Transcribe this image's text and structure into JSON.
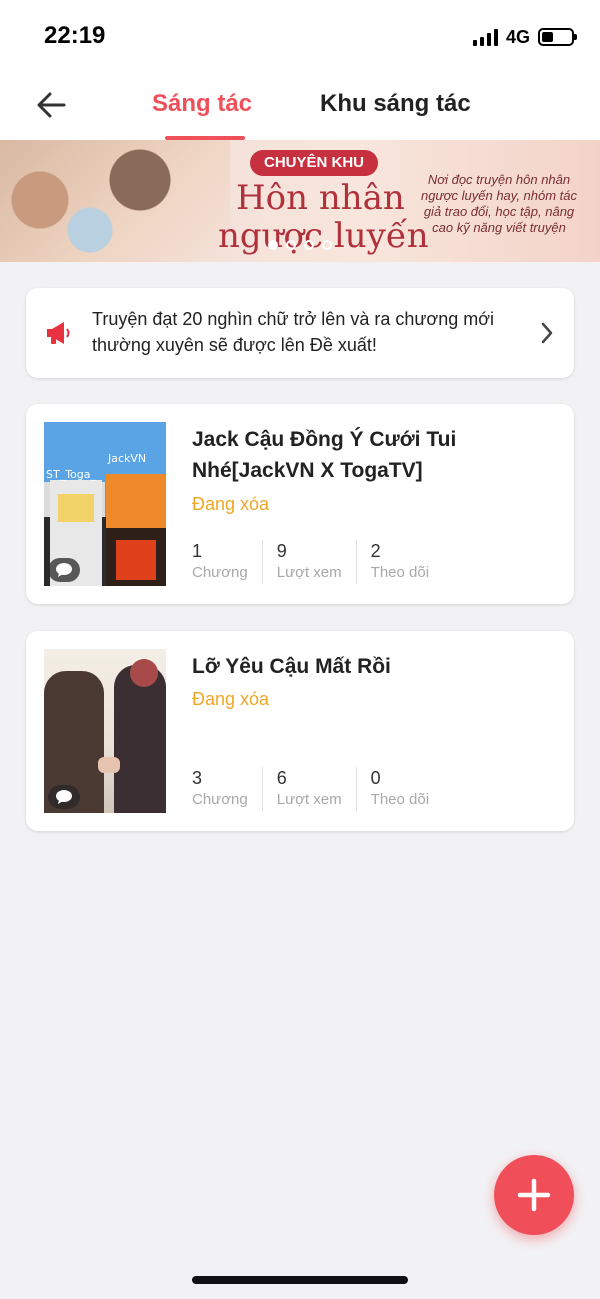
{
  "status_bar": {
    "time": "22:19",
    "network": "4G",
    "battery_level": 0.4
  },
  "header": {
    "back_icon": "arrow-left-icon",
    "tabs": [
      {
        "label": "Sáng tác",
        "active": true
      },
      {
        "label": "Khu sáng tác",
        "active": false
      }
    ],
    "accent_color": "#f0505a"
  },
  "banner": {
    "tag": "CHUYÊN KHU",
    "title_line1": "Hôn nhân",
    "title_line2": "ngược luyến",
    "description": "Nơi đọc truyện hôn nhân ngược luyến hay, nhóm tác giả trao đổi, học tập, nâng cao kỹ năng viết truyện",
    "dots": 4,
    "active_dot": 0
  },
  "notice": {
    "icon": "megaphone-icon",
    "text": "Truyện đạt 20 nghìn chữ trở lên và ra chương mới thường xuyên sẽ được lên Đề xuất!"
  },
  "stories": [
    {
      "title": "Jack Cậu Đồng Ý Cưới Tui Nhé[JackVN X TogaTV]",
      "status": "Đang xóa",
      "cover_text_left": "ST_Toga_",
      "cover_text_right": "JackVN",
      "stats": [
        {
          "value": "1",
          "label": "Chương"
        },
        {
          "value": "9",
          "label": "Lượt xem"
        },
        {
          "value": "2",
          "label": "Theo dõi"
        }
      ]
    },
    {
      "title": "Lỡ Yêu Cậu Mất Rồi",
      "status": "Đang xóa",
      "stats": [
        {
          "value": "3",
          "label": "Chương"
        },
        {
          "value": "6",
          "label": "Lượt xem"
        },
        {
          "value": "0",
          "label": "Theo dõi"
        }
      ]
    }
  ],
  "fab": {
    "icon": "plus-icon",
    "color": "#f04e58"
  },
  "status_color": "#f0a726"
}
